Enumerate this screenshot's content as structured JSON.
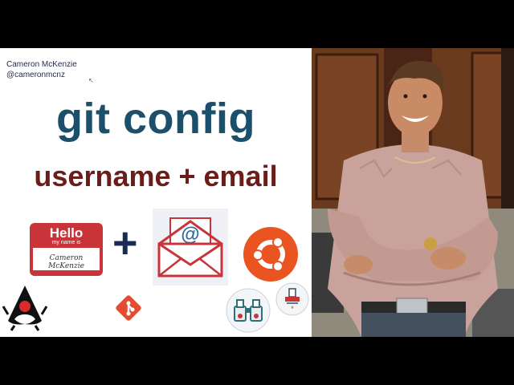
{
  "author": {
    "name": "Cameron McKenzie",
    "handle": "@cameronmcnz"
  },
  "slide": {
    "title": "git config",
    "subtitle": "username + email"
  },
  "name_tag": {
    "hello": "Hello",
    "my_name_is": "my name is",
    "name": "Cameron McKenzie"
  },
  "plus_sign": "+",
  "icons": {
    "envelope": "email-envelope-icon",
    "ubuntu": "ubuntu-logo-icon",
    "java": "java-duke-icon",
    "git": "git-logo-icon",
    "binoculars": "binoculars-icon",
    "cleaner": "cleaner-icon"
  },
  "colors": {
    "title": "#1c4f6b",
    "subtitle": "#6b1d1a",
    "tag_red": "#c8343a",
    "ubuntu_orange": "#e95420",
    "git_orange": "#e44c30"
  }
}
